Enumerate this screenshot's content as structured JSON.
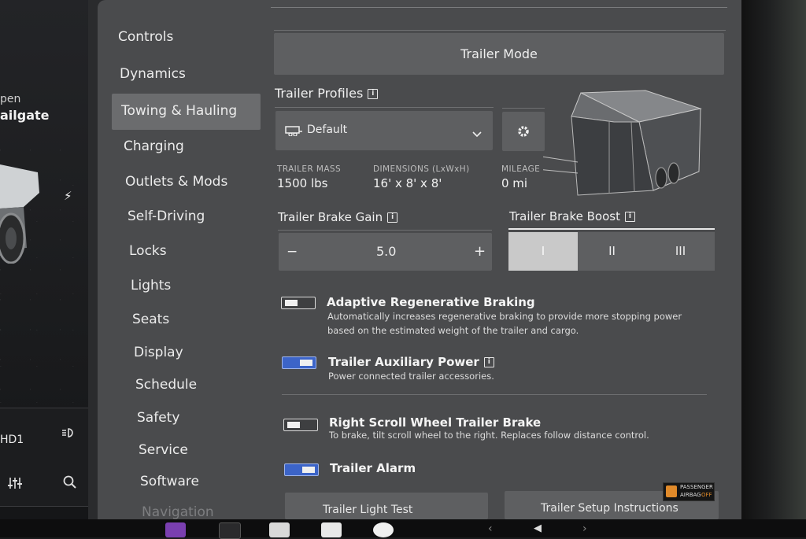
{
  "left_panel": {
    "status_small": "pen",
    "status_big": "ailgate",
    "bottom_label": "HD1"
  },
  "menu": {
    "items": [
      {
        "label": "Controls"
      },
      {
        "label": "Dynamics"
      },
      {
        "label": "Towing & Hauling"
      },
      {
        "label": "Charging"
      },
      {
        "label": "Outlets & Mods"
      },
      {
        "label": "Self-Driving"
      },
      {
        "label": "Locks"
      },
      {
        "label": "Lights"
      },
      {
        "label": "Seats"
      },
      {
        "label": "Display"
      },
      {
        "label": "Schedule"
      },
      {
        "label": "Safety"
      },
      {
        "label": "Service"
      },
      {
        "label": "Software"
      },
      {
        "label": "Navigation"
      }
    ],
    "active_index": 2
  },
  "trailer_mode": {
    "label": "Trailer Mode"
  },
  "trailer_profiles": {
    "title": "Trailer Profiles",
    "selected": "Default"
  },
  "stats": {
    "mass_label": "TRAILER MASS",
    "mass_value": "1500 lbs",
    "dims_label": "DIMENSIONS (LxWxH)",
    "dims_value": "16' x 8' x 8'",
    "mileage_label": "MILEAGE",
    "mileage_value": "0 mi"
  },
  "brake_gain": {
    "title": "Trailer Brake Gain",
    "value": "5.0",
    "minus": "−",
    "plus": "+"
  },
  "brake_boost": {
    "title": "Trailer Brake Boost",
    "options": [
      "I",
      "II",
      "III"
    ],
    "selected_index": 0
  },
  "options": [
    {
      "title": "Adaptive Regenerative Braking",
      "desc1": "Automatically increases regenerative braking to provide more stopping power",
      "desc2": "based on the estimated weight of the trailer and cargo.",
      "on": false
    },
    {
      "title": "Trailer Auxiliary Power",
      "desc1": "Power connected trailer accessories.",
      "on": true
    },
    {
      "title": "Right Scroll Wheel Trailer Brake",
      "desc1": "To brake, tilt scroll wheel to the right. Replaces follow distance control.",
      "on": false
    },
    {
      "title": "Trailer Alarm",
      "on": true
    }
  ],
  "bottom_buttons": {
    "light_test": "Trailer Light Test",
    "setup": "Trailer Setup Instructions"
  },
  "airbag": {
    "line1": "PASSENGER",
    "line2": "AIRBAG",
    "line3": "OFF"
  },
  "colors": {
    "toggle_on": "#3c64c8",
    "panel_bg": "#4a4b4d",
    "active_menu": "#6b6c6e"
  }
}
